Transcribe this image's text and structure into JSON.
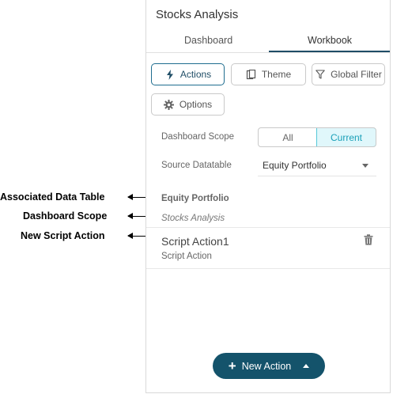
{
  "annotations": [
    {
      "label": "Associated Data Table"
    },
    {
      "label": "Dashboard Scope"
    },
    {
      "label": "New Script Action"
    }
  ],
  "panel": {
    "title": "Stocks Analysis",
    "tabs": [
      {
        "label": "Dashboard",
        "active": false
      },
      {
        "label": "Workbook",
        "active": true
      }
    ],
    "buttons": {
      "actions": "Actions",
      "theme": "Theme",
      "global_filter": "Global Filter",
      "options": "Options"
    },
    "dashboard_scope": {
      "label": "Dashboard Scope",
      "options": [
        "All",
        "Current"
      ],
      "selected": "Current"
    },
    "source_datatable": {
      "label": "Source Datatable",
      "value": "Equity Portfolio"
    },
    "group": {
      "table": "Equity Portfolio",
      "scope": "Stocks Analysis"
    },
    "action_item": {
      "name": "Script Action1",
      "type": "Script Action"
    },
    "new_action_button": "New Action"
  },
  "colors": {
    "accent": "#14536b",
    "selected_segment_bg": "#e0f7fb",
    "selected_segment_text": "#1aa0b8"
  }
}
